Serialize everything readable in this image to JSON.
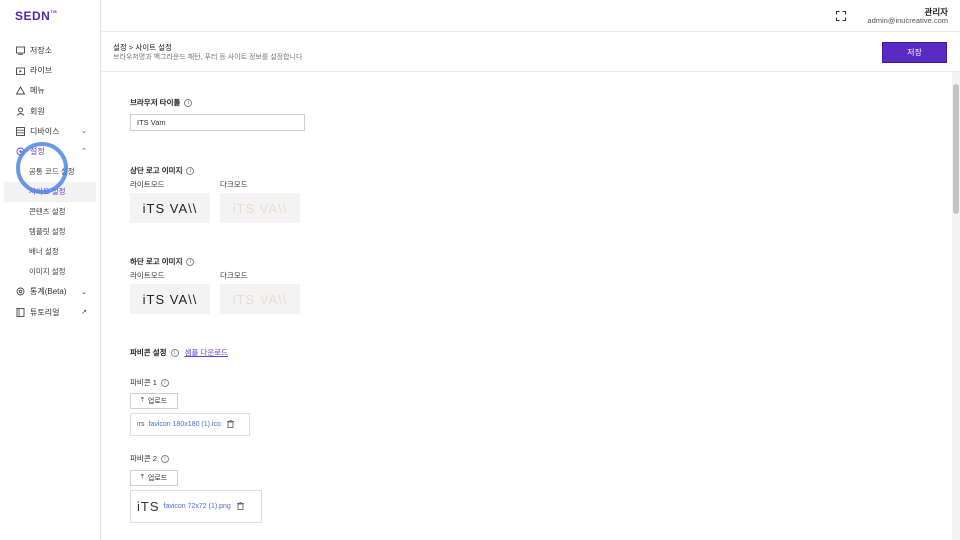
{
  "app": {
    "logo": "SEDN",
    "logo_mark": "TM"
  },
  "sidebar": {
    "items": [
      {
        "label": "저장소",
        "icon": "storage-icon"
      },
      {
        "label": "라이브",
        "icon": "live-icon"
      },
      {
        "label": "메뉴",
        "icon": "menu-icon"
      },
      {
        "label": "회원",
        "icon": "member-icon"
      },
      {
        "label": "디바이스",
        "icon": "device-icon",
        "chevron": "⌄"
      },
      {
        "label": "설정",
        "icon": "settings-icon",
        "chevron": "⌃"
      }
    ],
    "settings_sub": [
      "공통 코드 설정",
      "사이트 설정",
      "콘텐츠 설정",
      "템플릿 설정",
      "배너 설정",
      "이미지 설정"
    ],
    "bottom_items": [
      {
        "label": "통계(Beta)",
        "icon": "stats-icon",
        "chevron": "⌄"
      },
      {
        "label": "튜토리얼",
        "icon": "tutorial-icon",
        "chevron": "↗"
      }
    ]
  },
  "topbar": {
    "user_name": "관리자",
    "user_email": "admin@inucreative.com"
  },
  "page": {
    "breadcrumb": "설정 > 사이트 설정",
    "description": "브라우저명과 백그라운드 패턴, 푸터 등 사이트 정보를 설정합니다",
    "save_label": "저장"
  },
  "form": {
    "browser_title_label": "브라우저 타이틀",
    "browser_title_value": "ITS Vam",
    "top_logo_label": "상단 로고 이미지",
    "bottom_logo_label": "하단 로고 이미지",
    "light_mode": "라이트모드",
    "dark_mode": "다크모드",
    "logo_text": "iTS VA\\\\",
    "favicon_label": "파비콘 설정",
    "sample_download": "샘플 다운로드",
    "favicon1_label": "파비콘 1",
    "favicon2_label": "파비콘 2",
    "upload_label": "업로드",
    "favicon1_file": "favicon 180x180 (1).ico",
    "favicon2_file": "favicon 72x72 (1).png",
    "favicon_thumb_small": "iTS",
    "favicon_thumb_large": "iTS",
    "info_glyph": "i"
  },
  "colors": {
    "accent": "#5a2bc4",
    "link": "#4a6fd6",
    "cursor": "#4f86e8"
  }
}
